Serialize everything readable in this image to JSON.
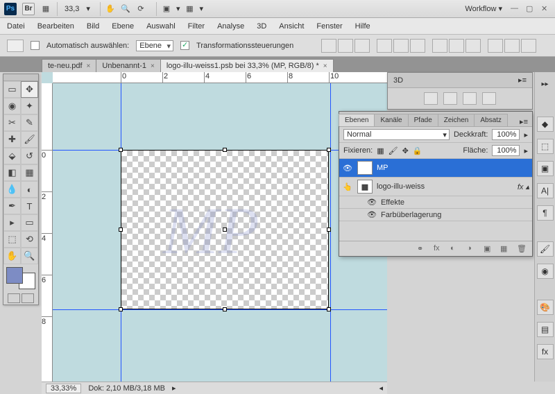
{
  "topbar": {
    "zoom": "33,3",
    "workflow": "Workflow ▾"
  },
  "menu": [
    "Datei",
    "Bearbeiten",
    "Bild",
    "Ebene",
    "Auswahl",
    "Filter",
    "Analyse",
    "3D",
    "Ansicht",
    "Fenster",
    "Hilfe"
  ],
  "options": {
    "auto_select_label": "Automatisch auswählen:",
    "target": "Ebene",
    "transform_label": "Transformationssteuerungen"
  },
  "tabs": [
    {
      "label": "te-neu.pdf",
      "active": false
    },
    {
      "label": "Unbenannt-1",
      "active": false
    },
    {
      "label": "logo-illu-weiss1.psb bei 33,3% (MP, RGB/8) *",
      "active": true
    }
  ],
  "ruler_h": [
    "0",
    "2",
    "4",
    "6",
    "8",
    "10"
  ],
  "ruler_v": [
    "0",
    "2",
    "4",
    "6",
    "8"
  ],
  "canvas": {
    "text": "MP"
  },
  "panel3d": {
    "title": "3D"
  },
  "layers": {
    "tabs": [
      "Ebenen",
      "Kanäle",
      "Pfade",
      "Zeichen",
      "Absatz"
    ],
    "blend_mode": "Normal",
    "opacity_label": "Deckkraft:",
    "opacity": "100%",
    "lock_label": "Fixieren:",
    "fill_label": "Fläche:",
    "fill": "100%",
    "items": [
      {
        "name": "MP",
        "type": "T",
        "selected": true
      },
      {
        "name": "logo-illu-weiss",
        "type": "smart",
        "fx": true
      }
    ],
    "effects_label": "Effekte",
    "color_overlay": "Farbüberlagerung"
  },
  "status": {
    "zoom": "33,33%",
    "doc": "Dok: 2,10 MB/3,18 MB"
  }
}
